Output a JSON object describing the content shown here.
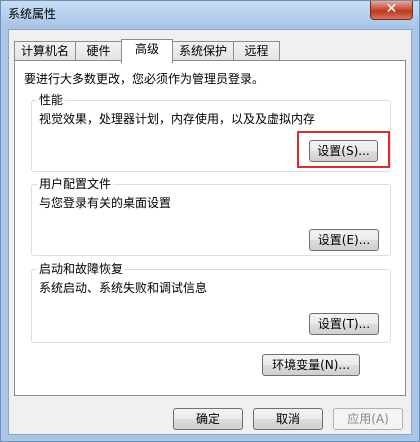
{
  "window": {
    "title": "系统属性",
    "close_glyph": "✕"
  },
  "tabs": [
    {
      "label": "计算机名"
    },
    {
      "label": "硬件"
    },
    {
      "label": "高级"
    },
    {
      "label": "系统保护"
    },
    {
      "label": "远程"
    }
  ],
  "advanced": {
    "notice": "要进行大多数更改，您必须作为管理员登录。",
    "performance": {
      "label": "性能",
      "desc": "视觉效果，处理器计划，内存使用，以及及虚拟内存",
      "button": "设置(S)..."
    },
    "profile": {
      "label": "用户配置文件",
      "desc": "与您登录有关的桌面设置",
      "button": "设置(E)..."
    },
    "startup": {
      "label": "启动和故障恢复",
      "desc": "系统启动、系统失败和调试信息",
      "button": "设置(T)..."
    },
    "env_button": "环境变量(N)..."
  },
  "footer": {
    "ok": "确定",
    "cancel": "取消",
    "apply": "应用(A)"
  },
  "colors": {
    "highlight": "#e02b2b"
  }
}
